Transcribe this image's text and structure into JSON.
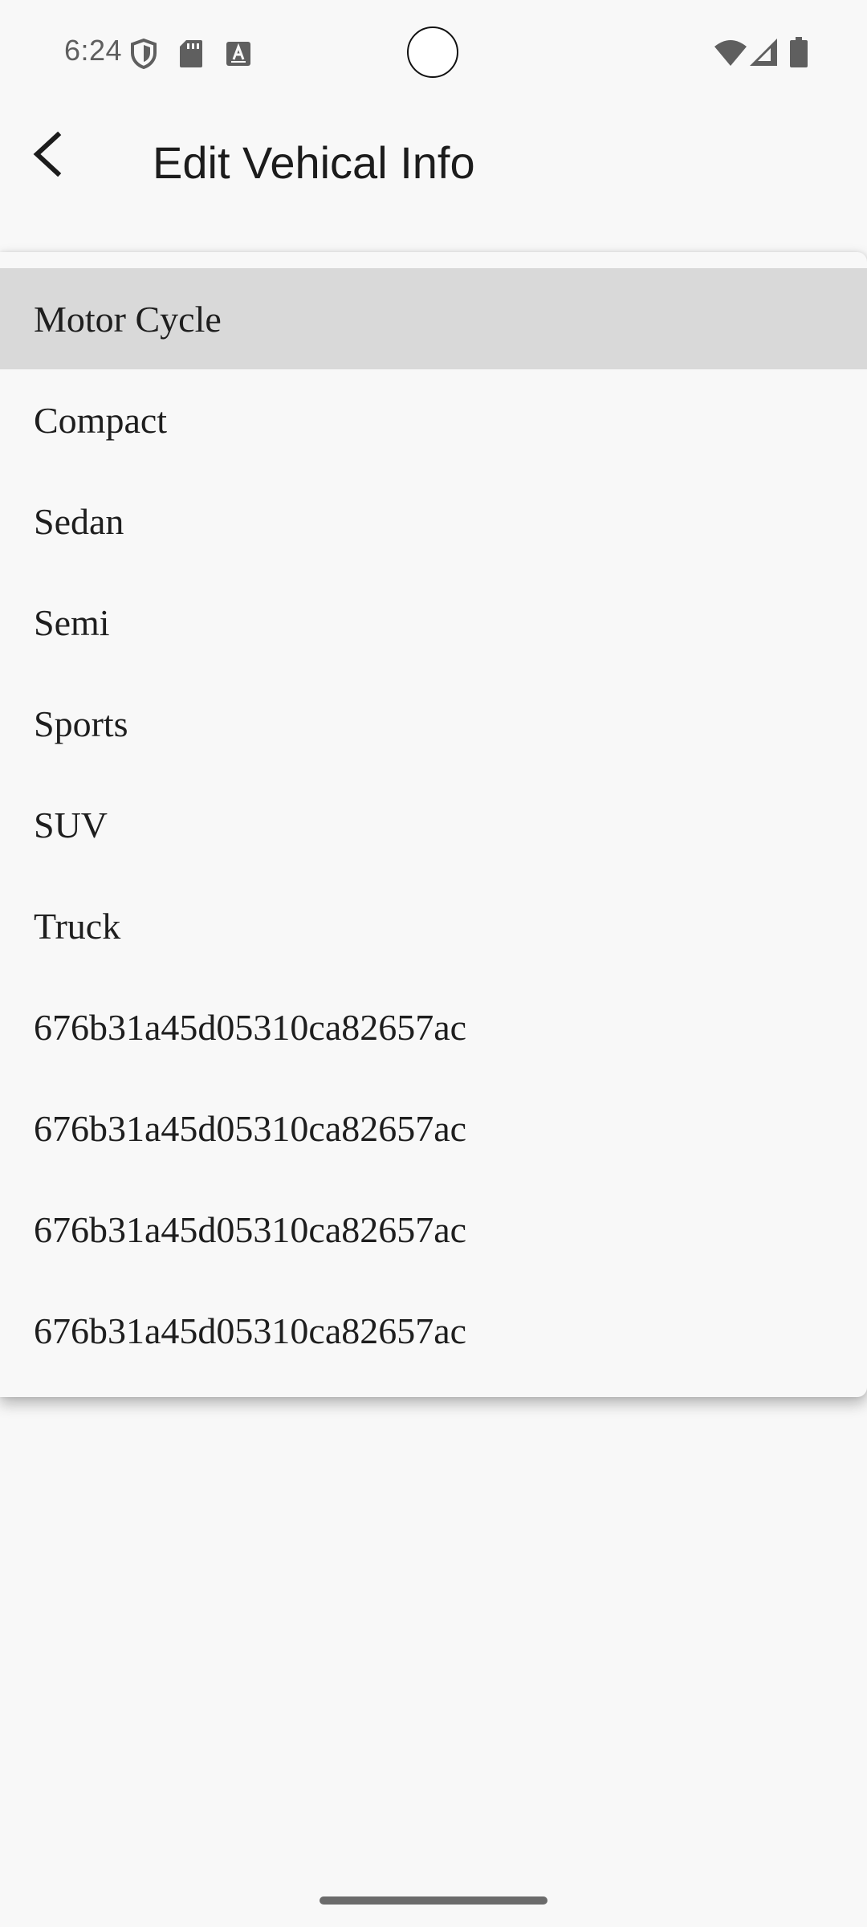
{
  "status_bar": {
    "time": "6:24",
    "left_icons": [
      "shield-icon",
      "sd-card-icon",
      "font-a-icon"
    ],
    "right_icons": [
      "wifi-icon",
      "cell-signal-icon",
      "battery-icon"
    ]
  },
  "app_bar": {
    "back_icon": "back-arrow-icon",
    "title": "Edit Vehical Info"
  },
  "dropdown": {
    "selected_index": 0,
    "items": [
      {
        "label": "Motor Cycle"
      },
      {
        "label": "Compact"
      },
      {
        "label": "Sedan"
      },
      {
        "label": "Semi"
      },
      {
        "label": "Sports"
      },
      {
        "label": "SUV"
      },
      {
        "label": "Truck"
      },
      {
        "label": "676b31a45d05310ca82657ac"
      },
      {
        "label": "676b31a45d05310ca82657ac"
      },
      {
        "label": "676b31a45d05310ca82657ac"
      },
      {
        "label": "676b31a45d05310ca82657ac"
      }
    ]
  },
  "colors": {
    "background": "#f8f8f8",
    "selected_item": "#d9d9d9",
    "text": "#1c1c1c",
    "status_icon": "#5f5f5f"
  }
}
